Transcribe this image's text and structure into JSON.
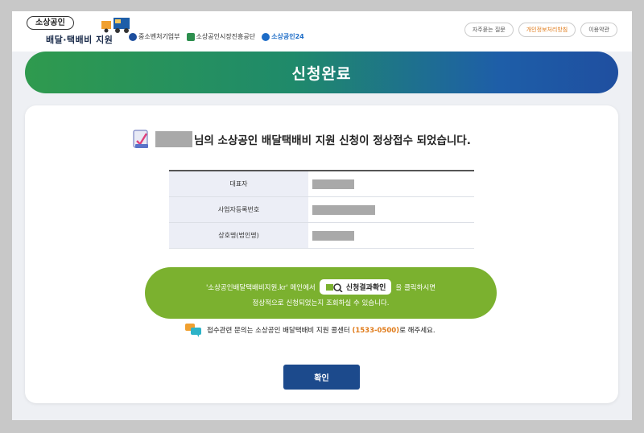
{
  "header": {
    "logo_top": "소상공인",
    "logo_main": "배달·택배비 지원",
    "partners": [
      {
        "label": "중소벤처기업부",
        "color": "#1d4e9e"
      },
      {
        "label": "소상공인시장진흥공단",
        "color": "#2d8f4e"
      },
      {
        "label": "소상공인24",
        "color": "#1d6cc7"
      }
    ],
    "links": [
      "자주묻는 질문",
      "개인정보처리방침",
      "이용약관"
    ]
  },
  "banner": {
    "title": "신청완료"
  },
  "headline": {
    "text": "님의 소상공인 배달택배비 지원 신청이 정상접수 되었습니다."
  },
  "info_table": {
    "rows": [
      {
        "label": "대표자"
      },
      {
        "label": "사업자등록번호"
      },
      {
        "label": "상호명(법인명)"
      }
    ]
  },
  "notice": {
    "line1_before": "'소상공인배달택배비지원.kr' 메인에서",
    "result_button": "신청결과확인",
    "line1_after": "을 클릭하시면",
    "line2": "정상적으로 신청되었는지 조회하실 수 있습니다."
  },
  "contact": {
    "text_before": "접수관련 문의는 소상공인 배달택배비 지원 콜센터 ",
    "phone": "(1533-0500)",
    "text_after": "로 해주세요."
  },
  "confirm_label": "확인",
  "colors": {
    "banner_start": "#2f9a4e",
    "banner_end": "#1f4fa0",
    "notice_green": "#7bb12f",
    "button_navy": "#1c4a8c",
    "accent_orange": "#e07b1a"
  }
}
